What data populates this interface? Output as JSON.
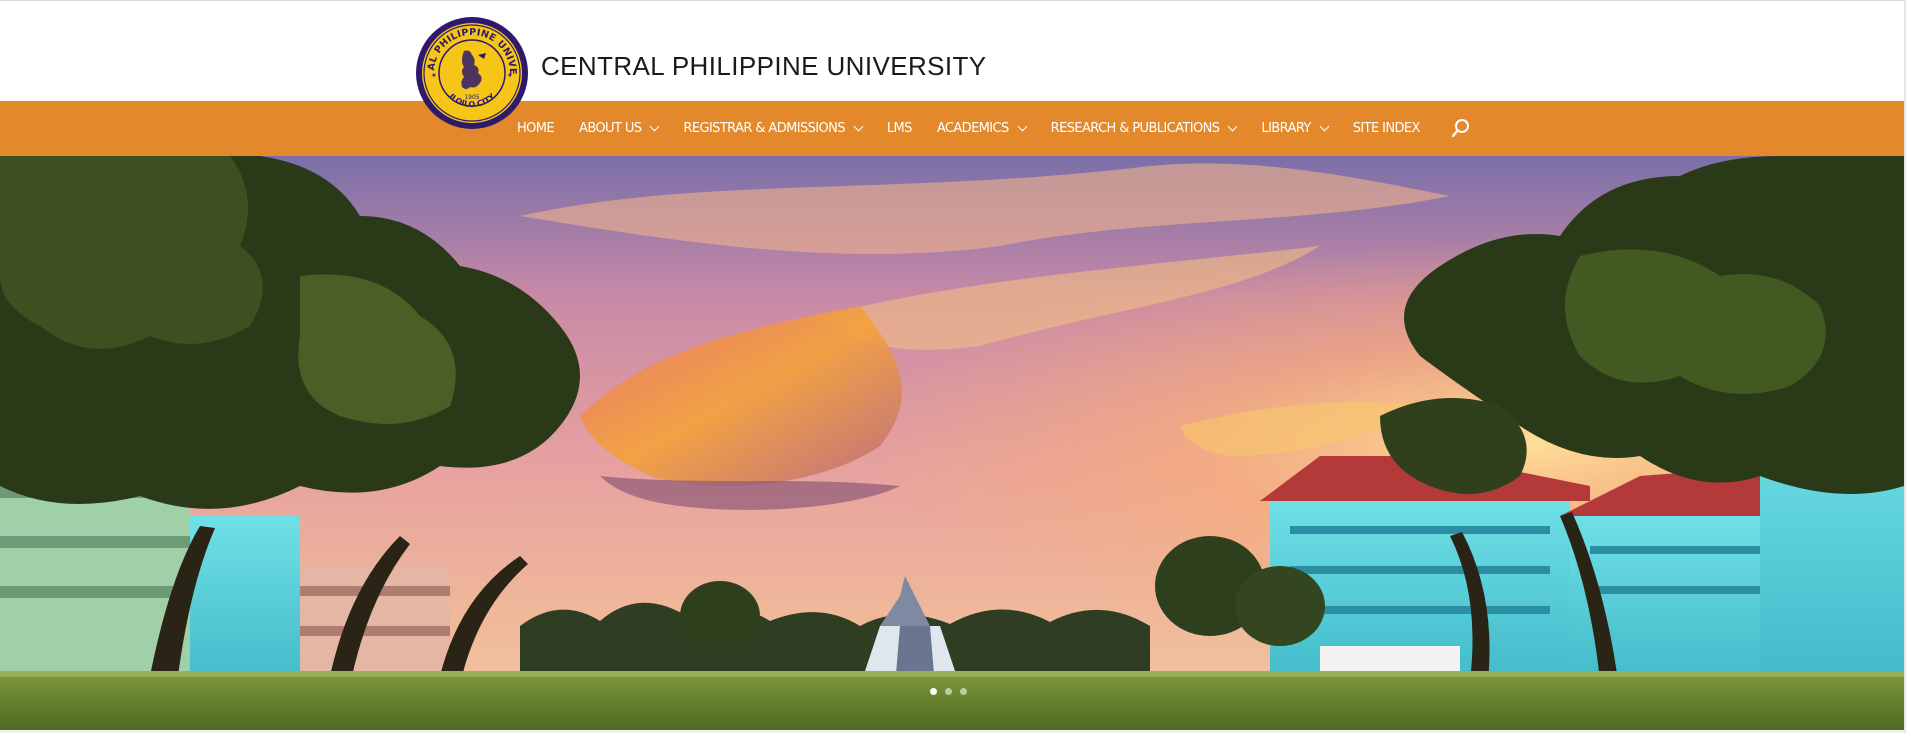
{
  "header": {
    "site_title": "CENTRAL PHILIPPINE UNIVERSITY",
    "logo": {
      "top_text": "CENTRAL PHILIPPINE UNIVERSITY",
      "bottom_text": "ILOILO CITY",
      "year": "1905",
      "colors": {
        "ring": "#2e1a6b",
        "fill": "#f5c518"
      }
    }
  },
  "nav": {
    "items": [
      {
        "label": "HOME",
        "has_dropdown": false
      },
      {
        "label": "ABOUT US",
        "has_dropdown": true
      },
      {
        "label": "REGISTRAR & ADMISSIONS",
        "has_dropdown": true
      },
      {
        "label": "LMS",
        "has_dropdown": false
      },
      {
        "label": "ACADEMICS",
        "has_dropdown": true
      },
      {
        "label": "RESEARCH & PUBLICATIONS",
        "has_dropdown": true
      },
      {
        "label": "LIBRARY",
        "has_dropdown": true
      },
      {
        "label": "SITE INDEX",
        "has_dropdown": false
      }
    ],
    "search_icon": "search-icon",
    "bar_color": "#e3892c"
  },
  "hero": {
    "slide_count": 3,
    "active_slide": 1
  }
}
